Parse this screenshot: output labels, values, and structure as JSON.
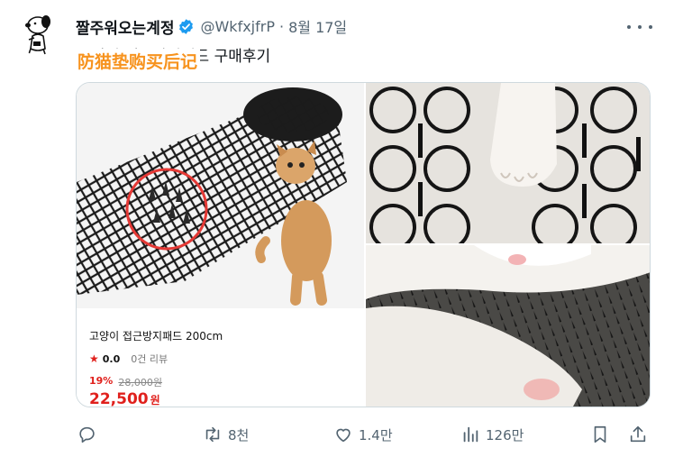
{
  "tweet": {
    "display_name": "짤주워오는계정",
    "handle": "@WkfxjfrP",
    "separator": "·",
    "date": "8월 17일",
    "text_partial": "고양이 접근방지패드 구매후기",
    "overlay_caption": "防猫垫购买后记"
  },
  "product_card": {
    "title": "고양이 접근방지패드 200cm",
    "star_icon": "star-icon",
    "rating": "0.0",
    "reviews": "0건 리뷰",
    "discount": "19%",
    "original_price": "28,000원",
    "price": "22,500",
    "currency": "원"
  },
  "actions": {
    "reply_count": "",
    "retweet_count": "8천",
    "like_count": "1.4만",
    "view_count": "126만"
  },
  "colors": {
    "accent_verified": "#1d9bf0",
    "caption_orange": "#f7931e",
    "price_red": "#e0201c",
    "muted_text": "#536471"
  }
}
